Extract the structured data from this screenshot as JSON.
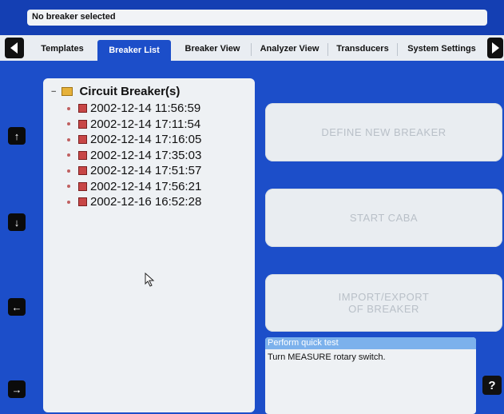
{
  "status": {
    "text": "No breaker selected"
  },
  "tabs": [
    {
      "label": "Templates"
    },
    {
      "label": "Breaker List"
    },
    {
      "label": "Breaker View"
    },
    {
      "label": "Analyzer View"
    },
    {
      "label": "Transducers"
    },
    {
      "label": "System Settings"
    }
  ],
  "active_tab": "Breaker List",
  "tree": {
    "root": "Circuit Breaker(s)",
    "items": [
      "2002-12-14 11:56:59",
      "2002-12-14 17:11:54",
      "2002-12-14 17:16:05",
      "2002-12-14 17:35:03",
      "2002-12-14 17:51:57",
      "2002-12-14 17:56:21",
      "2002-12-16 16:52:28"
    ]
  },
  "buttons": {
    "define": "DEFINE NEW BREAKER",
    "start": "START CABA",
    "import_line1": "IMPORT/EXPORT",
    "import_line2": "OF BREAKER"
  },
  "help": {
    "title": "Perform quick test",
    "text": "Turn MEASURE rotary switch."
  },
  "side_buttons": {
    "up": "↑",
    "down": "↓",
    "left": "←",
    "right": "→"
  },
  "help_button": "?",
  "colors": {
    "background": "#1c4ec9",
    "panel": "#eef1f4",
    "help_title": "#7cb1ec"
  }
}
